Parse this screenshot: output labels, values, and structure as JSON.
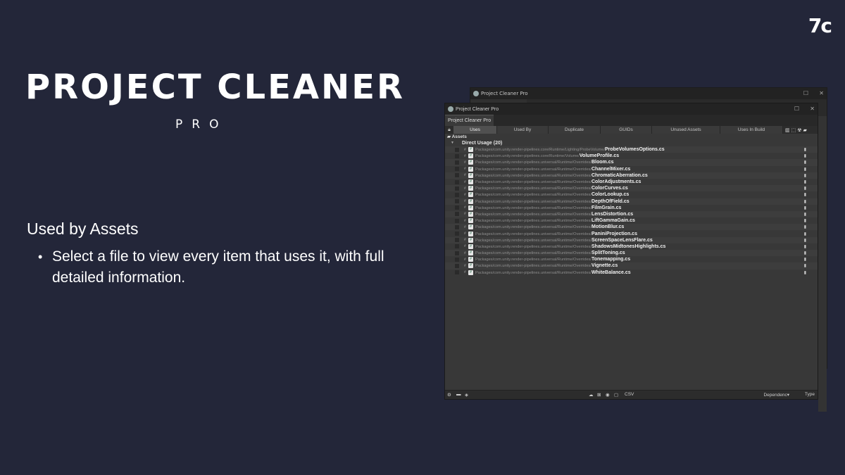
{
  "brand": {
    "logo": "7c"
  },
  "hero": {
    "title": "PROJECT CLEANER",
    "subtitle": "PRO"
  },
  "feature": {
    "heading": "Used by Assets",
    "bullet": "Select a file to view every item that uses it, with full detailed information."
  },
  "back_window": {
    "title": "Project Cleaner Pro"
  },
  "window": {
    "title": "Project Cleaner Pro",
    "tab": "Project Cleaner Pro",
    "toolbar": [
      {
        "label": "Uses",
        "active": true
      },
      {
        "label": "Used By",
        "active": false
      },
      {
        "label": "Duplicate",
        "active": false
      },
      {
        "label": "GUIDs",
        "active": false
      },
      {
        "label": "Unused Assets",
        "active": false
      },
      {
        "label": "Uses In Build",
        "active": false
      }
    ],
    "assets_label": "Assets",
    "group_label": "Direct Usage (20)",
    "rows": [
      {
        "path": "Packages/com.unity.render-pipelines.core/Runtime/Lighting/ProbeVolume/",
        "name": "ProbeVolumesOptions.cs"
      },
      {
        "path": "Packages/com.unity.render-pipelines.core/Runtime/Volume/",
        "name": "VolumeProfile.cs"
      },
      {
        "path": "Packages/com.unity.render-pipelines.universal/Runtime/Overrides/",
        "name": "Bloom.cs"
      },
      {
        "path": "Packages/com.unity.render-pipelines.universal/Runtime/Overrides/",
        "name": "ChannelMixer.cs"
      },
      {
        "path": "Packages/com.unity.render-pipelines.universal/Runtime/Overrides/",
        "name": "ChromaticAberration.cs"
      },
      {
        "path": "Packages/com.unity.render-pipelines.universal/Runtime/Overrides/",
        "name": "ColorAdjustments.cs"
      },
      {
        "path": "Packages/com.unity.render-pipelines.universal/Runtime/Overrides/",
        "name": "ColorCurves.cs"
      },
      {
        "path": "Packages/com.unity.render-pipelines.universal/Runtime/Overrides/",
        "name": "ColorLookup.cs"
      },
      {
        "path": "Packages/com.unity.render-pipelines.universal/Runtime/Overrides/",
        "name": "DepthOfField.cs"
      },
      {
        "path": "Packages/com.unity.render-pipelines.universal/Runtime/Overrides/",
        "name": "FilmGrain.cs"
      },
      {
        "path": "Packages/com.unity.render-pipelines.universal/Runtime/Overrides/",
        "name": "LensDistortion.cs"
      },
      {
        "path": "Packages/com.unity.render-pipelines.universal/Runtime/Overrides/",
        "name": "LiftGammaGain.cs"
      },
      {
        "path": "Packages/com.unity.render-pipelines.universal/Runtime/Overrides/",
        "name": "MotionBlur.cs"
      },
      {
        "path": "Packages/com.unity.render-pipelines.universal/Runtime/Overrides/",
        "name": "PaniniProjection.cs"
      },
      {
        "path": "Packages/com.unity.render-pipelines.universal/Runtime/Overrides/",
        "name": "ScreenSpaceLensFlare.cs"
      },
      {
        "path": "Packages/com.unity.render-pipelines.universal/Runtime/Overrides/",
        "name": "ShadowsMidtonesHighlights.cs"
      },
      {
        "path": "Packages/com.unity.render-pipelines.universal/Runtime/Overrides/",
        "name": "SplitToning.cs"
      },
      {
        "path": "Packages/com.unity.render-pipelines.universal/Runtime/Overrides/",
        "name": "Tonemapping.cs"
      },
      {
        "path": "Packages/com.unity.render-pipelines.universal/Runtime/Overrides/",
        "name": "Vignette.cs"
      },
      {
        "path": "Packages/com.unity.render-pipelines.universal/Runtime/Overrides/",
        "name": "WhiteBalance.cs"
      }
    ],
    "status": {
      "csv": "CSV",
      "dependency": "Dependenc▾",
      "type": "Type"
    }
  }
}
